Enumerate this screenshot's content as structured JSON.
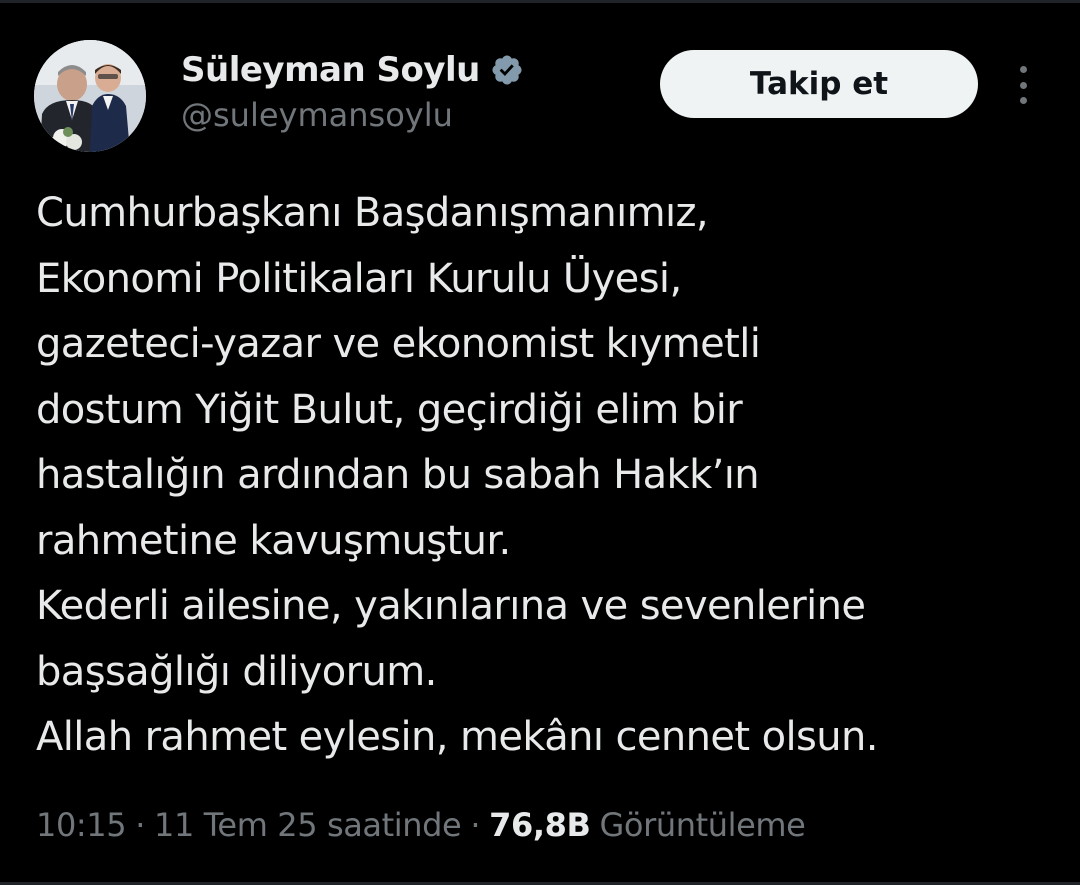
{
  "author": {
    "display_name": "Süleyman Soylu",
    "handle": "@suleymansoylu",
    "verified_icon": "verified-badge-icon",
    "avatar_icon": "profile-photo"
  },
  "actions": {
    "follow_label": "Takip et",
    "more_icon": "more-options-icon"
  },
  "tweet": {
    "lines": [
      "Cumhurbaşkanı Başdanışmanımız,",
      "Ekonomi Politikaları Kurulu Üyesi,",
      "gazeteci-yazar ve ekonomist kıymetli",
      "dostum Yiğit Bulut, geçirdiği elim bir",
      "hastalığın ardından bu sabah Hakk’ın",
      "rahmetine kavuşmuştur.",
      "Kederli ailesine, yakınlarına ve sevenlerine",
      "başsağlığı diliyorum.",
      "Allah rahmet eylesin, mekânı cennet olsun."
    ]
  },
  "meta": {
    "time": "10:15",
    "separator": "·",
    "date": "11 Tem 25 saatinde",
    "views_count": "76,8B",
    "views_label": "Görüntüleme"
  },
  "colors": {
    "background": "#000000",
    "text_primary": "#e7e9ea",
    "text_secondary": "#71767b",
    "verified": "#829aab",
    "button_bg": "#eff3f4",
    "button_text": "#0f1419"
  }
}
